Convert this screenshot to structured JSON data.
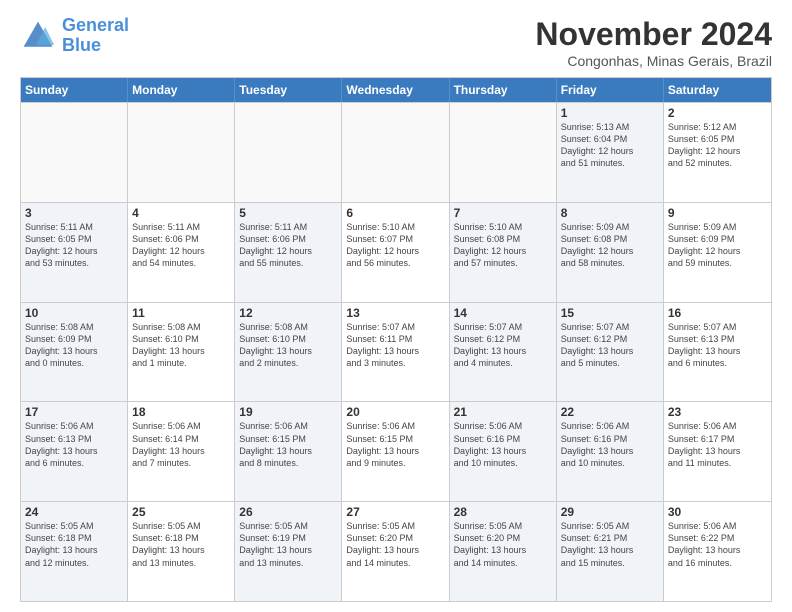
{
  "logo": {
    "line1": "General",
    "line2": "Blue"
  },
  "title": "November 2024",
  "subtitle": "Congonhas, Minas Gerais, Brazil",
  "header_days": [
    "Sunday",
    "Monday",
    "Tuesday",
    "Wednesday",
    "Thursday",
    "Friday",
    "Saturday"
  ],
  "rows": [
    [
      {
        "day": "",
        "text": "",
        "empty": true
      },
      {
        "day": "",
        "text": "",
        "empty": true
      },
      {
        "day": "",
        "text": "",
        "empty": true
      },
      {
        "day": "",
        "text": "",
        "empty": true
      },
      {
        "day": "",
        "text": "",
        "empty": true
      },
      {
        "day": "1",
        "text": "Sunrise: 5:13 AM\nSunset: 6:04 PM\nDaylight: 12 hours\nand 51 minutes.",
        "shaded": true
      },
      {
        "day": "2",
        "text": "Sunrise: 5:12 AM\nSunset: 6:05 PM\nDaylight: 12 hours\nand 52 minutes.",
        "shaded": false
      }
    ],
    [
      {
        "day": "3",
        "text": "Sunrise: 5:11 AM\nSunset: 6:05 PM\nDaylight: 12 hours\nand 53 minutes.",
        "shaded": true
      },
      {
        "day": "4",
        "text": "Sunrise: 5:11 AM\nSunset: 6:06 PM\nDaylight: 12 hours\nand 54 minutes.",
        "shaded": false
      },
      {
        "day": "5",
        "text": "Sunrise: 5:11 AM\nSunset: 6:06 PM\nDaylight: 12 hours\nand 55 minutes.",
        "shaded": true
      },
      {
        "day": "6",
        "text": "Sunrise: 5:10 AM\nSunset: 6:07 PM\nDaylight: 12 hours\nand 56 minutes.",
        "shaded": false
      },
      {
        "day": "7",
        "text": "Sunrise: 5:10 AM\nSunset: 6:08 PM\nDaylight: 12 hours\nand 57 minutes.",
        "shaded": true
      },
      {
        "day": "8",
        "text": "Sunrise: 5:09 AM\nSunset: 6:08 PM\nDaylight: 12 hours\nand 58 minutes.",
        "shaded": true
      },
      {
        "day": "9",
        "text": "Sunrise: 5:09 AM\nSunset: 6:09 PM\nDaylight: 12 hours\nand 59 minutes.",
        "shaded": false
      }
    ],
    [
      {
        "day": "10",
        "text": "Sunrise: 5:08 AM\nSunset: 6:09 PM\nDaylight: 13 hours\nand 0 minutes.",
        "shaded": true
      },
      {
        "day": "11",
        "text": "Sunrise: 5:08 AM\nSunset: 6:10 PM\nDaylight: 13 hours\nand 1 minute.",
        "shaded": false
      },
      {
        "day": "12",
        "text": "Sunrise: 5:08 AM\nSunset: 6:10 PM\nDaylight: 13 hours\nand 2 minutes.",
        "shaded": true
      },
      {
        "day": "13",
        "text": "Sunrise: 5:07 AM\nSunset: 6:11 PM\nDaylight: 13 hours\nand 3 minutes.",
        "shaded": false
      },
      {
        "day": "14",
        "text": "Sunrise: 5:07 AM\nSunset: 6:12 PM\nDaylight: 13 hours\nand 4 minutes.",
        "shaded": true
      },
      {
        "day": "15",
        "text": "Sunrise: 5:07 AM\nSunset: 6:12 PM\nDaylight: 13 hours\nand 5 minutes.",
        "shaded": true
      },
      {
        "day": "16",
        "text": "Sunrise: 5:07 AM\nSunset: 6:13 PM\nDaylight: 13 hours\nand 6 minutes.",
        "shaded": false
      }
    ],
    [
      {
        "day": "17",
        "text": "Sunrise: 5:06 AM\nSunset: 6:13 PM\nDaylight: 13 hours\nand 6 minutes.",
        "shaded": true
      },
      {
        "day": "18",
        "text": "Sunrise: 5:06 AM\nSunset: 6:14 PM\nDaylight: 13 hours\nand 7 minutes.",
        "shaded": false
      },
      {
        "day": "19",
        "text": "Sunrise: 5:06 AM\nSunset: 6:15 PM\nDaylight: 13 hours\nand 8 minutes.",
        "shaded": true
      },
      {
        "day": "20",
        "text": "Sunrise: 5:06 AM\nSunset: 6:15 PM\nDaylight: 13 hours\nand 9 minutes.",
        "shaded": false
      },
      {
        "day": "21",
        "text": "Sunrise: 5:06 AM\nSunset: 6:16 PM\nDaylight: 13 hours\nand 10 minutes.",
        "shaded": true
      },
      {
        "day": "22",
        "text": "Sunrise: 5:06 AM\nSunset: 6:16 PM\nDaylight: 13 hours\nand 10 minutes.",
        "shaded": true
      },
      {
        "day": "23",
        "text": "Sunrise: 5:06 AM\nSunset: 6:17 PM\nDaylight: 13 hours\nand 11 minutes.",
        "shaded": false
      }
    ],
    [
      {
        "day": "24",
        "text": "Sunrise: 5:05 AM\nSunset: 6:18 PM\nDaylight: 13 hours\nand 12 minutes.",
        "shaded": true
      },
      {
        "day": "25",
        "text": "Sunrise: 5:05 AM\nSunset: 6:18 PM\nDaylight: 13 hours\nand 13 minutes.",
        "shaded": false
      },
      {
        "day": "26",
        "text": "Sunrise: 5:05 AM\nSunset: 6:19 PM\nDaylight: 13 hours\nand 13 minutes.",
        "shaded": true
      },
      {
        "day": "27",
        "text": "Sunrise: 5:05 AM\nSunset: 6:20 PM\nDaylight: 13 hours\nand 14 minutes.",
        "shaded": false
      },
      {
        "day": "28",
        "text": "Sunrise: 5:05 AM\nSunset: 6:20 PM\nDaylight: 13 hours\nand 14 minutes.",
        "shaded": true
      },
      {
        "day": "29",
        "text": "Sunrise: 5:05 AM\nSunset: 6:21 PM\nDaylight: 13 hours\nand 15 minutes.",
        "shaded": true
      },
      {
        "day": "30",
        "text": "Sunrise: 5:06 AM\nSunset: 6:22 PM\nDaylight: 13 hours\nand 16 minutes.",
        "shaded": false
      }
    ]
  ]
}
